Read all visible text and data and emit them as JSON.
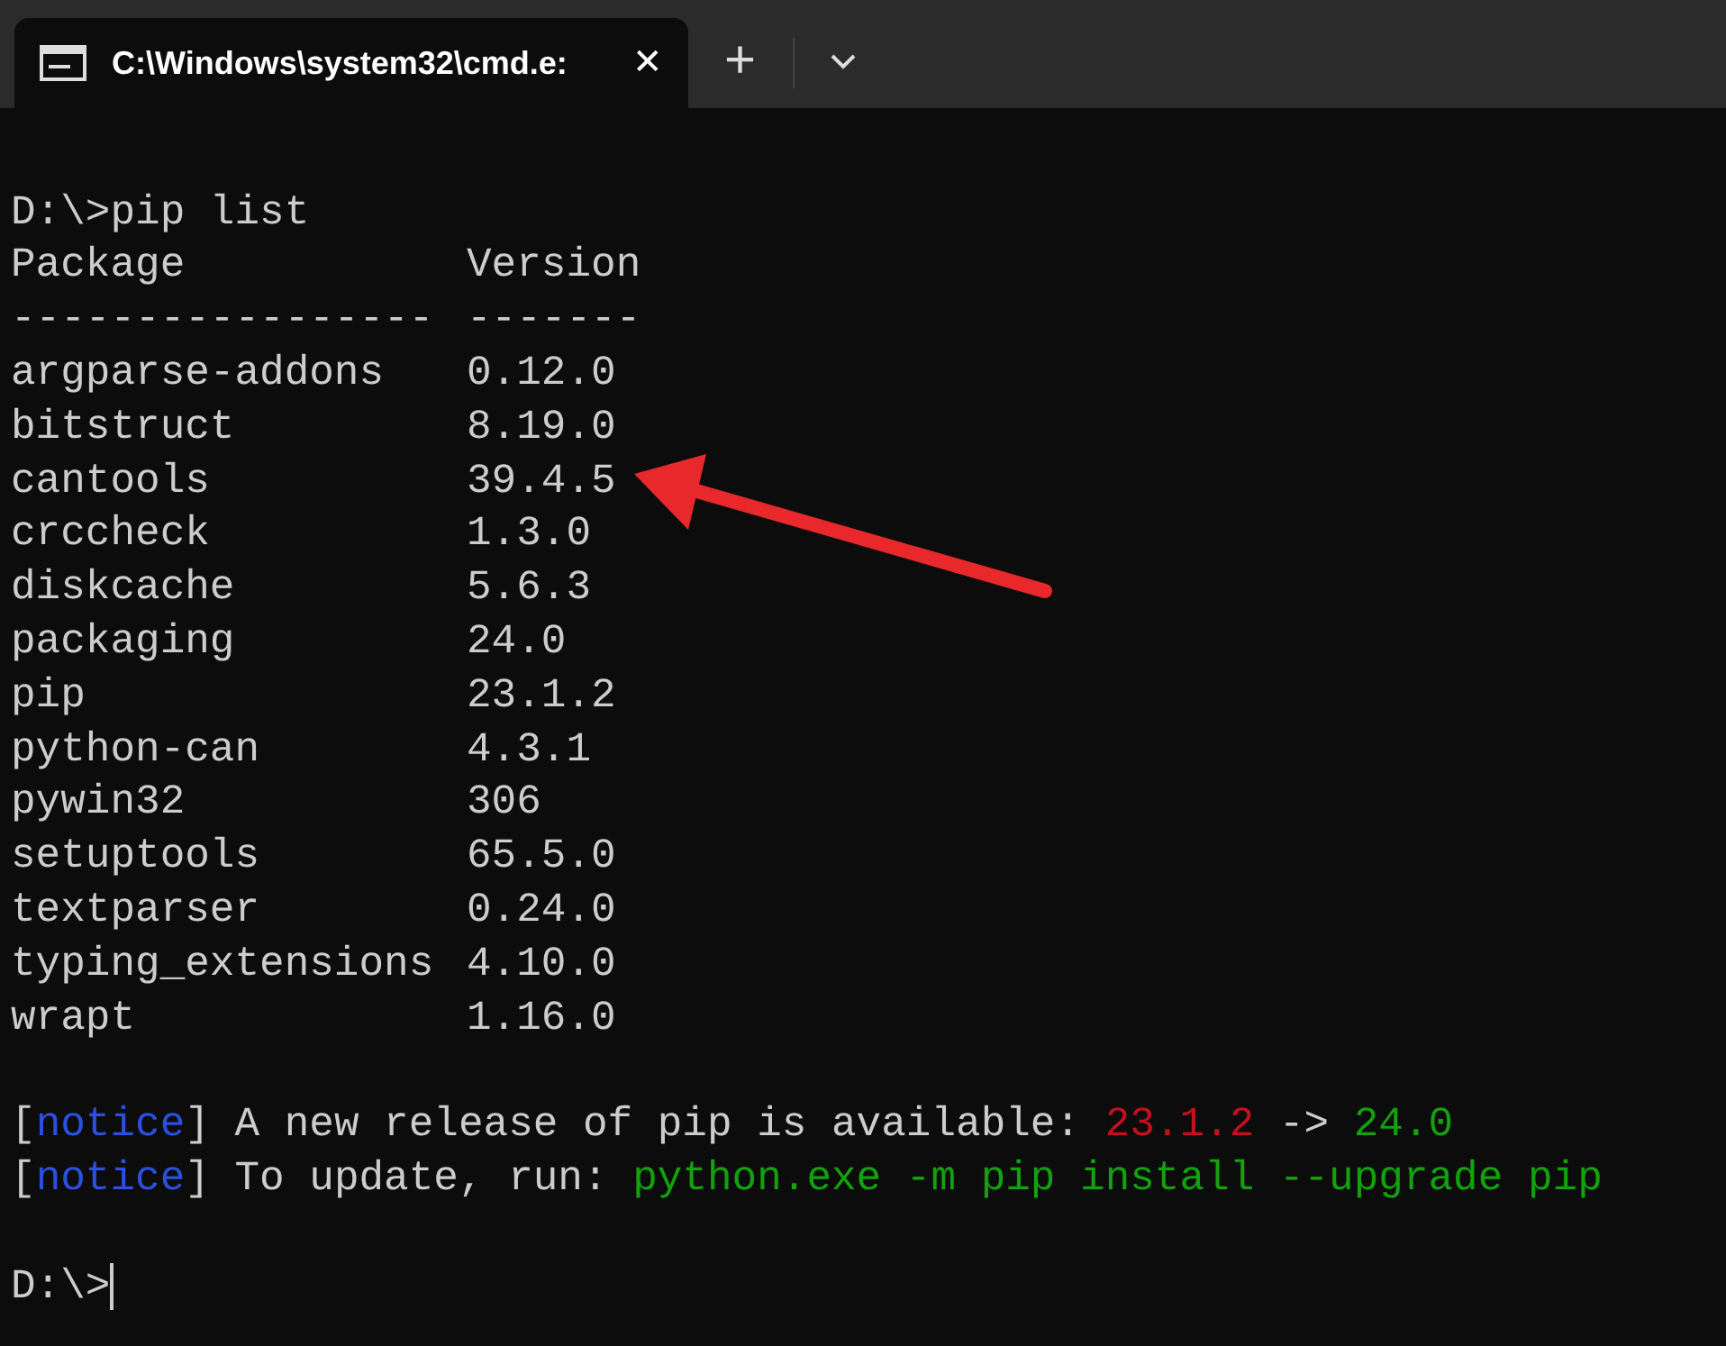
{
  "tab": {
    "title": "C:\\Windows\\system32\\cmd.e:",
    "close": "✕",
    "new_tab": "+"
  },
  "command": "D:\\>pip list",
  "table": {
    "columns": [
      "Package",
      "Version"
    ],
    "separators": [
      "-----------------",
      "-------"
    ],
    "rows": [
      [
        "argparse-addons",
        "0.12.0"
      ],
      [
        "bitstruct",
        "8.19.0"
      ],
      [
        "cantools",
        "39.4.5"
      ],
      [
        "crccheck",
        "1.3.0"
      ],
      [
        "diskcache",
        "5.6.3"
      ],
      [
        "packaging",
        "24.0"
      ],
      [
        "pip",
        "23.1.2"
      ],
      [
        "python-can",
        "4.3.1"
      ],
      [
        "pywin32",
        "306"
      ],
      [
        "setuptools",
        "65.5.0"
      ],
      [
        "textparser",
        "0.24.0"
      ],
      [
        "typing_extensions",
        "4.10.0"
      ],
      [
        "wrapt",
        "1.16.0"
      ]
    ]
  },
  "notices": [
    {
      "segments": [
        {
          "text": "[",
          "color": "#cccccc"
        },
        {
          "text": "notice",
          "color": "#2b4fe0"
        },
        {
          "text": "] A new release of pip is available:",
          "color": "#cccccc"
        },
        {
          "text": "23.1.2",
          "color": "#c50f1f"
        },
        {
          "text": "->",
          "color": "#cccccc"
        },
        {
          "text": "24.0",
          "color": "#13a10e"
        }
      ]
    },
    {
      "segments": [
        {
          "text": "[",
          "color": "#cccccc"
        },
        {
          "text": "notice",
          "color": "#2b4fe0"
        },
        {
          "text": "] To update, run:",
          "color": "#cccccc"
        },
        {
          "text": "python.exe -m pip install --upgrade pip",
          "color": "#13a10e"
        }
      ]
    }
  ],
  "prompt": "D:\\>"
}
